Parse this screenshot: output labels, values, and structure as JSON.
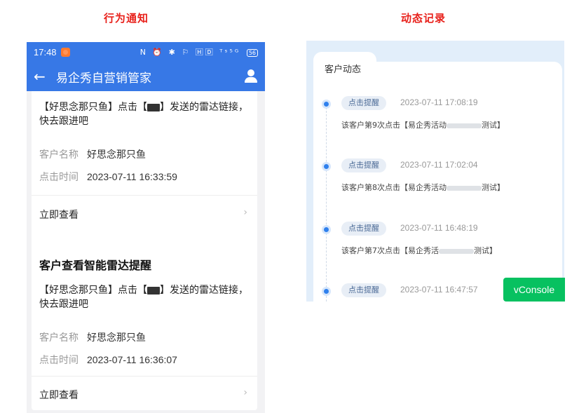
{
  "captions": {
    "left": "行为通知",
    "right": "动态记录"
  },
  "phone": {
    "status_bar": {
      "time": "17:48",
      "icons": "N ⏰ ✱ ⚐ 🄷🄳 ᵀˢ⁵ᴳ",
      "battery": "56"
    },
    "nav": {
      "title": "易企秀自营销管家"
    },
    "cards": [
      {
        "title": "",
        "msg_prefix": "【好思念那只鱼】点击【",
        "msg_suffix": "】发送的雷达链接，快去跟进吧",
        "name_label": "客户名称",
        "name_value": "好思念那只鱼",
        "time_label": "点击时间",
        "time_value": "2023-07-11 16:33:59",
        "link_label": "立即查看"
      },
      {
        "title": "客户查看智能雷达提醒",
        "msg_prefix": "【好思念那只鱼】点击【",
        "msg_suffix": "】发送的雷达链接，快去跟进吧",
        "name_label": "客户名称",
        "name_value": "好思念那只鱼",
        "time_label": "点击时间",
        "time_value": "2023-07-11 16:36:07",
        "link_label": "立即查看"
      }
    ]
  },
  "timeline": {
    "title": "客户动态",
    "items": [
      {
        "badge": "点击提醒",
        "time": "2023-07-11 17:08:19",
        "desc_prefix": "该客户第9次点击【易企秀活动",
        "desc_suffix": "测试】"
      },
      {
        "badge": "点击提醒",
        "time": "2023-07-11 17:02:04",
        "desc_prefix": "该客户第8次点击【易企秀活动",
        "desc_suffix": "测试】"
      },
      {
        "badge": "点击提醒",
        "time": "2023-07-11 16:48:19",
        "desc_prefix": "该客户第7次点击【易企秀活",
        "desc_suffix": "测试】"
      },
      {
        "badge": "点击提醒",
        "time": "2023-07-11 16:47:57",
        "desc_prefix": "",
        "desc_suffix": ""
      }
    ]
  },
  "vconsole": {
    "label": "vConsole"
  },
  "colors": {
    "caption": "#e8201a",
    "primary": "#3778e6",
    "vconsole": "#07c160",
    "timeline_dot": "#2f80ed"
  }
}
